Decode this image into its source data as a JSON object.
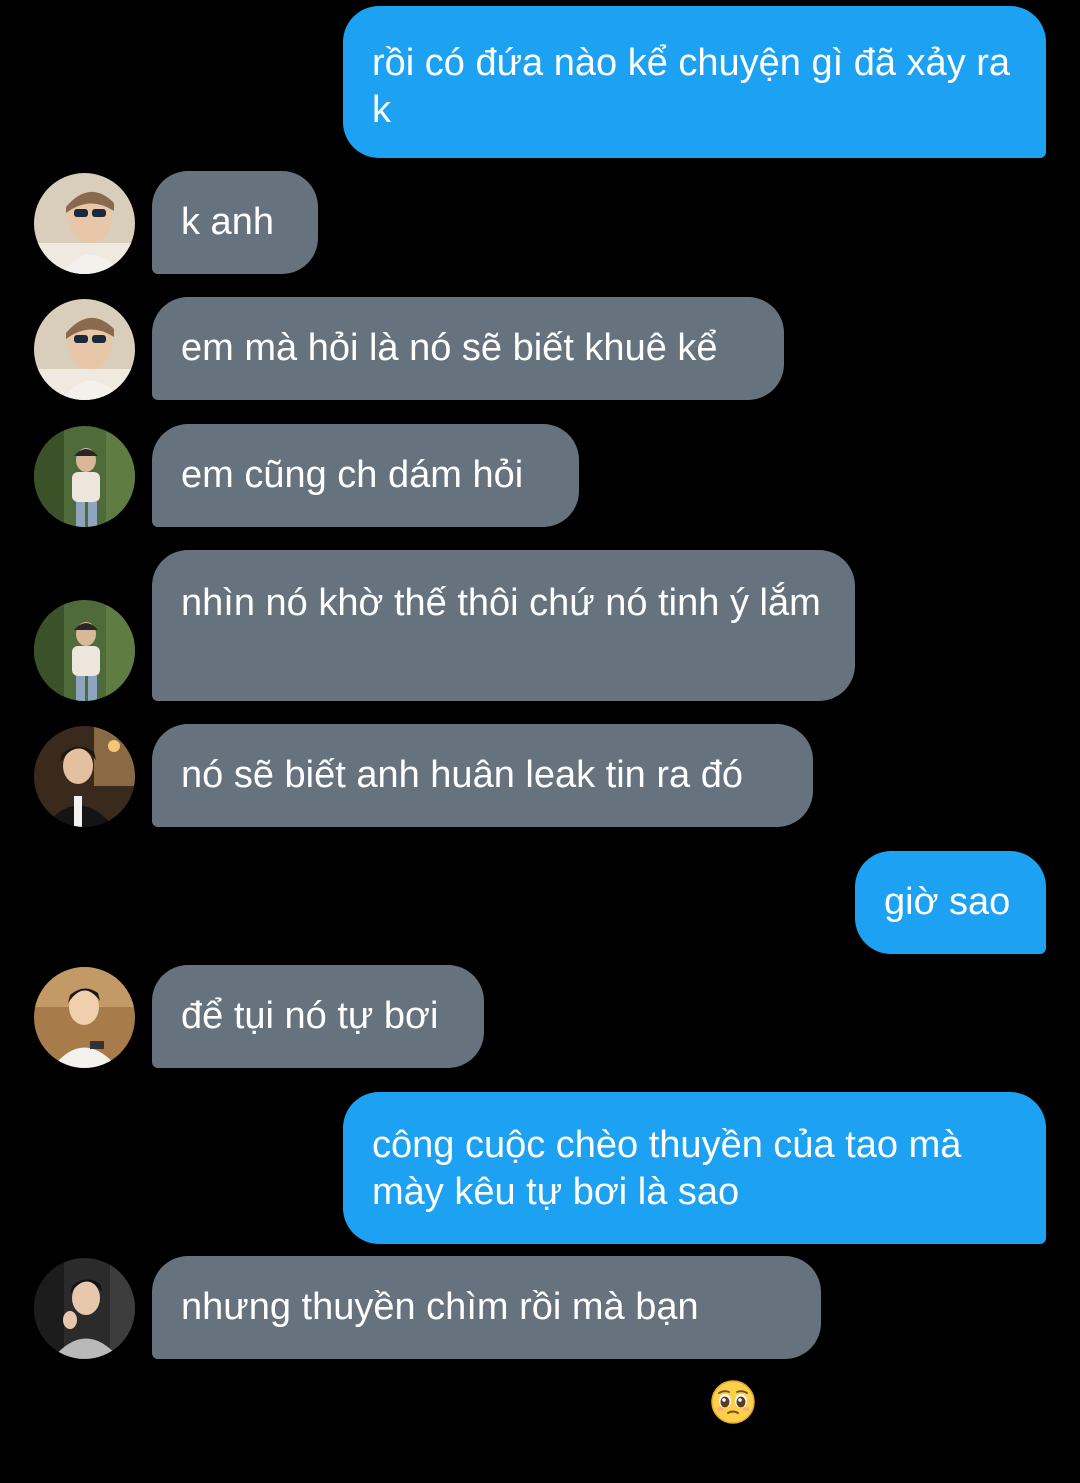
{
  "messages": [
    {
      "side": "out",
      "text": "rồi có đứa nào kể chuyện gì đã xảy ra k"
    },
    {
      "side": "in",
      "avatar": "avatar-1",
      "text": "k anh"
    },
    {
      "side": "in",
      "avatar": "avatar-1",
      "text": "em mà hỏi là nó sẽ biết khuê kể"
    },
    {
      "side": "in",
      "avatar": "avatar-2",
      "text": "em cũng ch dám hỏi"
    },
    {
      "side": "in",
      "avatar": "avatar-2",
      "text": "nhìn nó khờ thế thôi chứ nó tinh ý lắm"
    },
    {
      "side": "in",
      "avatar": "avatar-3",
      "text": "nó sẽ biết anh huân leak tin ra đó"
    },
    {
      "side": "out",
      "text": "giờ sao"
    },
    {
      "side": "in",
      "avatar": "avatar-4",
      "text": "để tụi nó tự bơi"
    },
    {
      "side": "out",
      "text": "công cuộc chèo thuyền của tao mà mày kêu tự bơi là sao"
    },
    {
      "side": "in",
      "avatar": "avatar-5",
      "text": "nhưng thuyền chìm rồi mà bạn",
      "emoji": "pleading-face-icon"
    }
  ],
  "colors": {
    "background": "#000000",
    "outgoing_bubble": "#1da1f2",
    "incoming_bubble": "#66737f",
    "text": "#ffffff"
  }
}
